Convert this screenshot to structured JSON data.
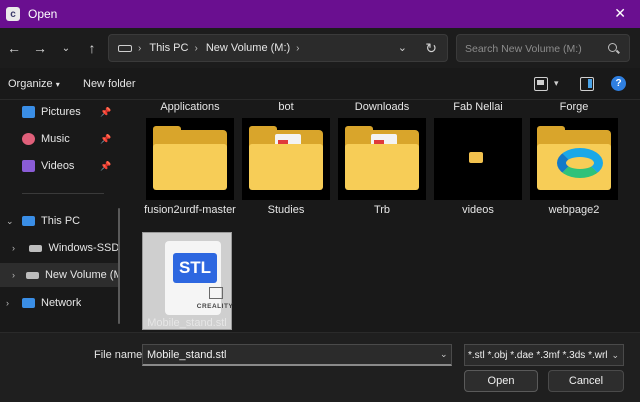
{
  "window": {
    "title": "Open",
    "close_icon": "close-icon"
  },
  "nav": {
    "breadcrumbs": [
      "This PC",
      "New Volume (M:)"
    ],
    "search_placeholder": "Search New Volume (M:)"
  },
  "commands": {
    "organize": "Organize",
    "new_folder": "New folder",
    "help": "?"
  },
  "sidebar": {
    "quick_access": [
      {
        "label": "Pictures",
        "icon": "pictures-icon",
        "color": "#3a8ee6"
      },
      {
        "label": "Music",
        "icon": "music-icon",
        "color": "#e0607a"
      },
      {
        "label": "Videos",
        "icon": "videos-icon",
        "color": "#8a5cd6"
      }
    ],
    "this_pc": {
      "label": "This PC",
      "color": "#3a8ee6"
    },
    "drives": [
      {
        "label": "Windows-SSD",
        "color": "#bdbdbd"
      },
      {
        "label": "New Volume (M:)",
        "color": "#bdbdbd"
      }
    ],
    "network": {
      "label": "Network",
      "color": "#3a8ee6"
    }
  },
  "files": {
    "row0": [
      "Applications",
      "bot",
      "Downloads",
      "Fab Nellai",
      "Forge"
    ],
    "row1": [
      "fusion2urdf-master",
      "Studies",
      "Trb",
      "videos",
      "webpage2"
    ],
    "row2": [
      {
        "label": "Mobile_stand.stl",
        "tag": "STL",
        "brand": "CREALITY"
      }
    ]
  },
  "footer": {
    "filename_label": "File name:",
    "filename_value": "Mobile_stand.stl",
    "filter_value": "*.stl *.obj *.dae *.3mf *.3ds *.wrl",
    "open_label": "Open",
    "cancel_label": "Cancel"
  },
  "colors": {
    "titlebar": "#6a0f90",
    "folder": "#f7cd57",
    "accent": "#2d67e0"
  }
}
